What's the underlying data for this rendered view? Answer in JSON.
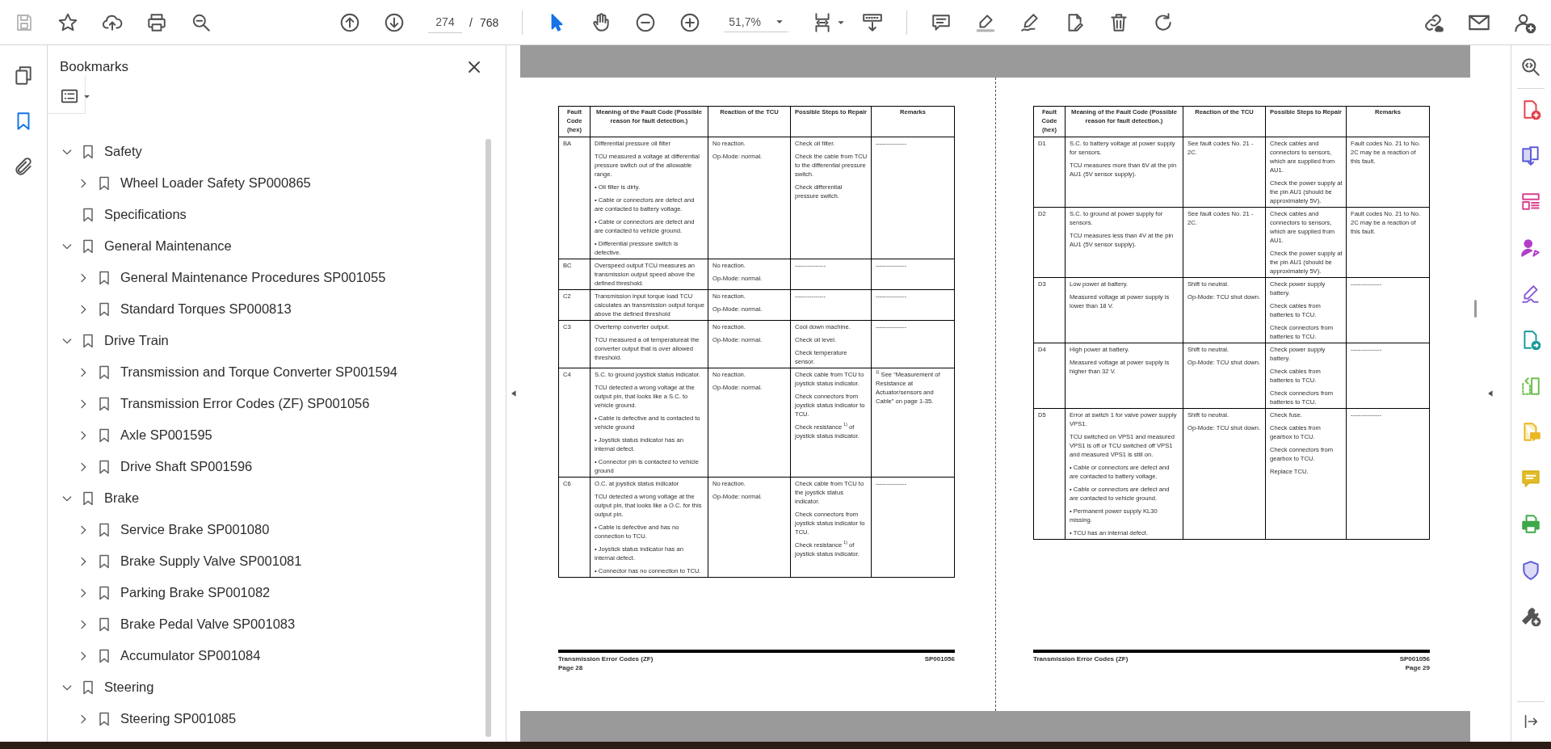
{
  "toolbar": {
    "save_disabled": true,
    "page_number": "274",
    "page_separator": "/",
    "page_count": "768",
    "pointer_selected": true,
    "zoom": "51,7%"
  },
  "left_rail": {
    "bookmarks_selected": true
  },
  "bookmarks": {
    "title": "Bookmarks",
    "items": [
      {
        "label": "Safety",
        "kind": "folder",
        "expanded": true,
        "children": [
          {
            "label": "Wheel Loader Safety SP000865",
            "kind": "folder",
            "expanded": false
          }
        ]
      },
      {
        "label": "Specifications",
        "kind": "leaf"
      },
      {
        "label": "General Maintenance",
        "kind": "folder",
        "expanded": true,
        "children": [
          {
            "label": "General Maintenance Procedures SP001055",
            "kind": "folder",
            "expanded": false
          },
          {
            "label": "Standard Torques SP000813",
            "kind": "folder",
            "expanded": false
          }
        ]
      },
      {
        "label": "Drive Train",
        "kind": "folder",
        "expanded": true,
        "children": [
          {
            "label": "Transmission and Torque Converter SP001594",
            "kind": "folder",
            "expanded": false
          },
          {
            "label": "Transmission Error Codes (ZF) SP001056",
            "kind": "folder",
            "expanded": false
          },
          {
            "label": "Axle SP001595",
            "kind": "folder",
            "expanded": false
          },
          {
            "label": "Drive Shaft SP001596",
            "kind": "folder",
            "expanded": false
          }
        ]
      },
      {
        "label": "Brake",
        "kind": "folder",
        "expanded": true,
        "children": [
          {
            "label": "Service Brake SP001080",
            "kind": "folder",
            "expanded": false
          },
          {
            "label": "Brake Supply Valve SP001081",
            "kind": "folder",
            "expanded": false
          },
          {
            "label": "Parking Brake SP001082",
            "kind": "folder",
            "expanded": false
          },
          {
            "label": "Brake Pedal Valve SP001083",
            "kind": "folder",
            "expanded": false
          },
          {
            "label": "Accumulator SP001084",
            "kind": "folder",
            "expanded": false
          }
        ]
      },
      {
        "label": "Steering",
        "kind": "folder",
        "expanded": true,
        "children": [
          {
            "label": "Steering SP001085",
            "kind": "folder",
            "expanded": false
          }
        ]
      }
    ]
  },
  "pages": [
    {
      "table": {
        "columns": [
          "Fault Code (hex)",
          "Meaning of the Fault Code (Possible reason for fault detection.)",
          "Reaction of the TCU",
          "Possible Steps to Repair",
          "Remarks"
        ],
        "rows": [
          {
            "code": "BA",
            "meaning": [
              "Differential pressure oil filter",
              "TCU measured a voltage at differential pressure switch out of the allowable range.",
              "• Oil filter is dirty.",
              "• Cable or connectors are defect and are contacted to battery voltage.",
              "• Cable or connectors are defect and are contacted to vehicle ground.",
              "• Differential pressure switch is defective."
            ],
            "reaction": [
              "No reaction.",
              "Op-Mode: normal."
            ],
            "steps": [
              "Check oil filter.",
              "Check the cable from TCU to the differential pressure switch.",
              "Check differential pressure switch."
            ],
            "remarks": [
              "---------------"
            ]
          },
          {
            "code": "BC",
            "meaning": [
              "Overspeed output TCU measures an transmission output speed above the defined threshold."
            ],
            "reaction": [
              "No reaction.",
              "Op-Mode: normal."
            ],
            "steps": [
              "---------------"
            ],
            "remarks": [
              "---------------"
            ]
          },
          {
            "code": "C2",
            "meaning": [
              "Transmission input torque load TCU calculates an transmission output torque above the defined threshold"
            ],
            "reaction": [
              "No reaction.",
              "Op-Mode: normal."
            ],
            "steps": [
              "---------------"
            ],
            "remarks": [
              "---------------"
            ]
          },
          {
            "code": "C3",
            "meaning": [
              "Overtemp converter output.",
              "TCU measured a oil temperatureat the converter output that is over allowed threshold."
            ],
            "reaction": [
              "No reaction.",
              "Op-Mode: normal."
            ],
            "steps": [
              "Cool down machine.",
              "Check oil level.",
              "Check temperature sensor."
            ],
            "remarks": [
              "---------------"
            ]
          },
          {
            "code": "C4",
            "meaning": [
              "S.C. to ground joystick status indicator.",
              "TCU detected a wrong voltage at the output pin, that looks like a S.C. to vehicle ground.",
              "• Cable is defective and is contacted to vehicle ground",
              "• Joystick status indicator has an internal defect.",
              "• Connector pin is contacted to vehicle ground"
            ],
            "reaction": [
              "No reaction.",
              "Op-Mode: normal."
            ],
            "steps": [
              "Check cable from TCU to joystick status indicator.",
              "Check connectors from joystick status indicator to TCU.",
              "Check resistance $^{1)}$ of joystick status indicator."
            ],
            "remarks": [
              "$^{1)}$ See “Measurement of Resistance at Actuator/sensors and Cable” on page 1-35."
            ]
          },
          {
            "code": "C6",
            "meaning": [
              "O.C. at joystick status indicator",
              "TCU detected a wrong voltage at the output pin, that looks like a O.C. for this output pin.",
              "• Cable is defective and has no connection to TCU.",
              "• Joystick status indicator has an internal defect.",
              "• Connector has no connection to TCU."
            ],
            "reaction": [
              "No reaction.",
              "Op-Mode: normal."
            ],
            "steps": [
              "Check cable from TCU to the joystick status indicator.",
              "Check connectors from joystick status indicator to TCU.",
              "Check resistance $^{1)}$ of joystick status indicator."
            ],
            "remarks": [
              "---------------"
            ]
          }
        ]
      },
      "footer": {
        "left_lines": [
          "Transmission Error Codes (ZF)",
          "Page 28"
        ],
        "right_lines": [
          "SP001056"
        ]
      }
    },
    {
      "table": {
        "columns": [
          "Fault Code (hex)",
          "Meaning of the Fault Code (Possible reason for fault detection.)",
          "Reaction of the TCU",
          "Possible Steps to Repair",
          "Remarks"
        ],
        "rows": [
          {
            "code": "D1",
            "meaning": [
              "S.C. to battery voltage at power supply for sensors.",
              "TCU measures more than 6V at the pin AU1 (5V sensor supply)."
            ],
            "reaction": [
              "See fault codes No. 21 - 2C."
            ],
            "steps": [
              "Check cables and connectors to sensors, which are supplied from AU1.",
              "Check the power supply at the pin AU1 (should be approximately 5V)."
            ],
            "remarks": [
              "Fault codes No. 21 to No. 2C may be a reaction of this fault."
            ]
          },
          {
            "code": "D2",
            "meaning": [
              "S.C. to ground at power supply for sensors.",
              "TCU measures less than 4V at the pin AU1 (5V sensor supply)."
            ],
            "reaction": [
              "See fault codes No. 21 - 2C."
            ],
            "steps": [
              "Check cables and connectors to sensors, which are supplied from AU1.",
              "Check the power supply at the pin AU1 (should be approximately 5V)."
            ],
            "remarks": [
              "Fault codes No. 21 to No. 2C may be a reaction of this fault."
            ]
          },
          {
            "code": "D3",
            "meaning": [
              "Low power at battery.",
              "Measured voltage at power supply is lower than 18 V."
            ],
            "reaction": [
              "Shift to neutral.",
              "Op-Mode: TCU shut down."
            ],
            "steps": [
              "Check power supply battery.",
              "Check cables from batteries to TCU.",
              "Check connectors from batteries to TCU."
            ],
            "remarks": [
              "---------------"
            ]
          },
          {
            "code": "D4",
            "meaning": [
              "High power at battery.",
              "Measured voltage at power supply is higher than 32 V."
            ],
            "reaction": [
              "Shift to neutral.",
              "Op-Mode: TCU shut down."
            ],
            "steps": [
              "Check power supply battery.",
              "Check cables from batteries to TCU.",
              "Check connectors from batteries to TCU."
            ],
            "remarks": [
              "---------------"
            ]
          },
          {
            "code": "D5",
            "meaning": [
              "Error at switch 1 for valve power supply VPS1.",
              "TCU switched on VPS1 and measured VPS1 is off or TCU switched off VPS1 and measured VPS1 is still on.",
              "• Cable or connectors are defect and are contacted to battery voltage.",
              "• Cable or connectors are defect and are contacted to vehicle ground.",
              "• Permanent power supply KL30 missing.",
              "• TCU has an internal defect."
            ],
            "reaction": [
              "Shift to neutral.",
              "Op-Mode: TCU shut down."
            ],
            "steps": [
              "Check fuse.",
              "Check cables from gearbox to TCU.",
              "Check connectors from gearbox to TCU.",
              "Replace TCU."
            ],
            "remarks": [
              "---------------"
            ]
          }
        ]
      },
      "footer": {
        "left_lines": [
          "Transmission Error Codes (ZF)"
        ],
        "right_lines": [
          "SP001056",
          "Page 29"
        ]
      }
    }
  ]
}
